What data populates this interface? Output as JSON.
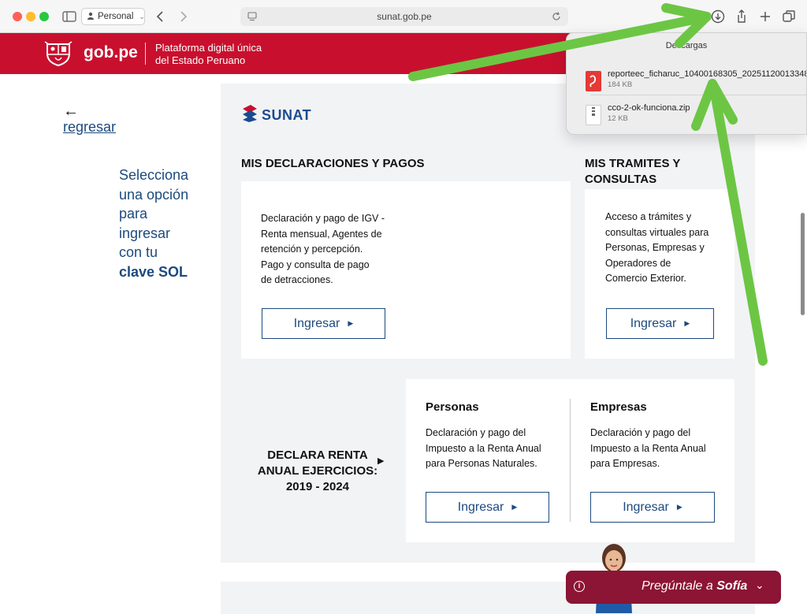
{
  "browser": {
    "profile": "Personal",
    "url": "sunat.gob.pe"
  },
  "gov_header": {
    "logo": "gob.pe",
    "subtitle_line1": "Plataforma digital única",
    "subtitle_line2": "del Estado Peruano"
  },
  "nav": {
    "back_arrow": "←",
    "back_link": "regresar"
  },
  "side_text": {
    "line1": "Selecciona",
    "line2": "una opción",
    "line3": "para",
    "line4": "ingresar",
    "line5": "con tu",
    "line6": "clave SOL"
  },
  "brand": {
    "name": "SUNAT"
  },
  "declaraciones": {
    "heading": "MIS DECLARACIONES Y PAGOS",
    "text_1": "Declaración y pago de IGV -",
    "text_2": "Renta mensual, Agentes de",
    "text_3": "retención y percepción.",
    "text_4": "Pago y consulta de pago",
    "text_5": "de detracciones.",
    "button": "Ingresar"
  },
  "tramites": {
    "heading_1": "MIS TRAMITES Y",
    "heading_2": "CONSULTAS",
    "text_1": "Acceso a trámites y",
    "text_2": "consultas virtuales para",
    "text_3": "Personas, Empresas y",
    "text_4": "Operadores de",
    "text_5": "Comercio Exterior.",
    "button": "Ingresar"
  },
  "renta_anual": {
    "line1": "DECLARA RENTA",
    "line2": "ANUAL EJERCICIOS:",
    "line3": "2019 - 2024",
    "arrow": "▶",
    "personas": {
      "title": "Personas",
      "text_1": "Declaración y pago del",
      "text_2": "Impuesto a la Renta Anual",
      "text_3": "para Personas Naturales.",
      "button": "Ingresar"
    },
    "empresas": {
      "title": "Empresas",
      "text_1": "Declaración y pago del",
      "text_2": "Impuesto a la Renta Anual",
      "text_3": "para Empresas.",
      "button": "Ingresar"
    }
  },
  "downloads": {
    "title": "Descargas",
    "items": [
      {
        "name": "reporteec_ficharuc_10400168305_20251120013348",
        "size": "184 KB",
        "icon": "pdf-file-icon"
      },
      {
        "name": "cco-2-ok-funciona.zip",
        "size": "12 KB",
        "icon": "zip-file-icon"
      }
    ]
  },
  "chat": {
    "prefix": "Pregúntale a ",
    "name": "Sofía",
    "info_glyph": "i",
    "chevron": "⌄"
  },
  "colors": {
    "gov_red": "#c8102e",
    "sunat_blue": "#1c4a7e",
    "sofia_maroon": "#8c1434",
    "arrow_green": "#6cc644"
  }
}
